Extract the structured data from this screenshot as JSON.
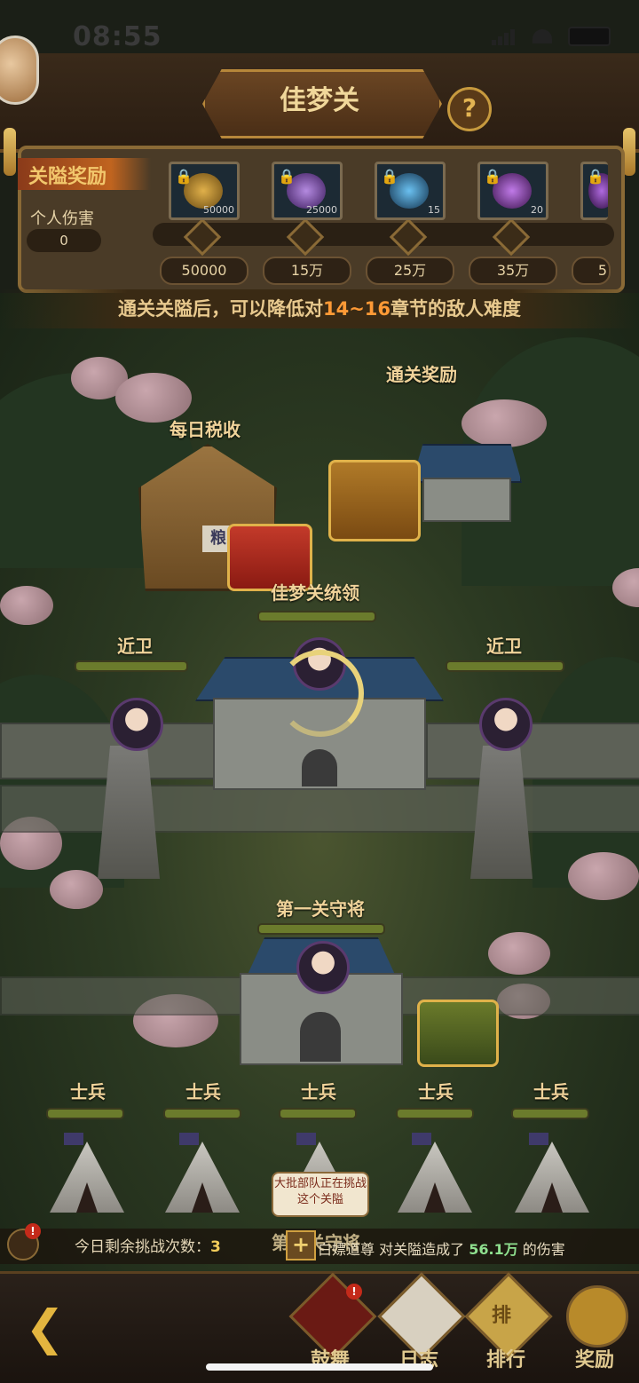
{
  "status_bar": {
    "time": "08:55"
  },
  "header": {
    "title": "佳梦关",
    "help_label": "?"
  },
  "rewards": {
    "title": "关隘奖励",
    "damage_label": "个人伤害",
    "damage_value": "0",
    "items": [
      {
        "icon": "coin-chest-icon",
        "qty": "50000",
        "color": "#b88a2a"
      },
      {
        "icon": "purple-scroll-icon",
        "qty": "25000",
        "color": "#7b4fb0"
      },
      {
        "icon": "blue-crystal-icon",
        "qty": "15",
        "color": "#2d8ad0"
      },
      {
        "icon": "purple-weapon-icon",
        "qty": "20",
        "color": "#8a3ac0"
      },
      {
        "icon": "purple-item-icon",
        "qty": "",
        "color": "#7a3ab0"
      }
    ],
    "thresholds": [
      "50000",
      "15万",
      "25万",
      "35万",
      "5"
    ]
  },
  "tip": {
    "prefix": "通关关隘后，可以降低对",
    "highlight": "14~16",
    "suffix": "章节的敌人难度"
  },
  "map": {
    "clear_reward_label": "通关奖励",
    "daily_tax_label": "每日税收",
    "commander_label": "佳梦关统领",
    "guard_left_label": "近卫",
    "guard_right_label": "近卫",
    "first_gate_label": "第一关守将",
    "soldier_labels": [
      "士兵",
      "士兵",
      "士兵",
      "士兵",
      "士兵"
    ],
    "sign_text": "粮",
    "bubble_text": "大批部队正在挑战这个关隘",
    "partial_label": "第一关守将"
  },
  "info_bar": {
    "challenges_label": "今日剩余挑战次数：",
    "challenges_count": "3",
    "news_name": "白嫖道尊",
    "news_mid": "对关隘造成了",
    "news_amount": "56.1万",
    "news_suffix": "的伤害"
  },
  "bottom_nav": [
    {
      "label": "鼓舞",
      "icon": "drum-icon",
      "badge": "!"
    },
    {
      "label": "日志",
      "icon": "log-book-icon",
      "badge": ""
    },
    {
      "label": "排行",
      "icon": "ranking-scroll-icon",
      "badge": ""
    },
    {
      "label": "奖励",
      "icon": "coin-reward-icon",
      "badge": ""
    }
  ],
  "badge_text": "!",
  "ranking_glyph": "排"
}
